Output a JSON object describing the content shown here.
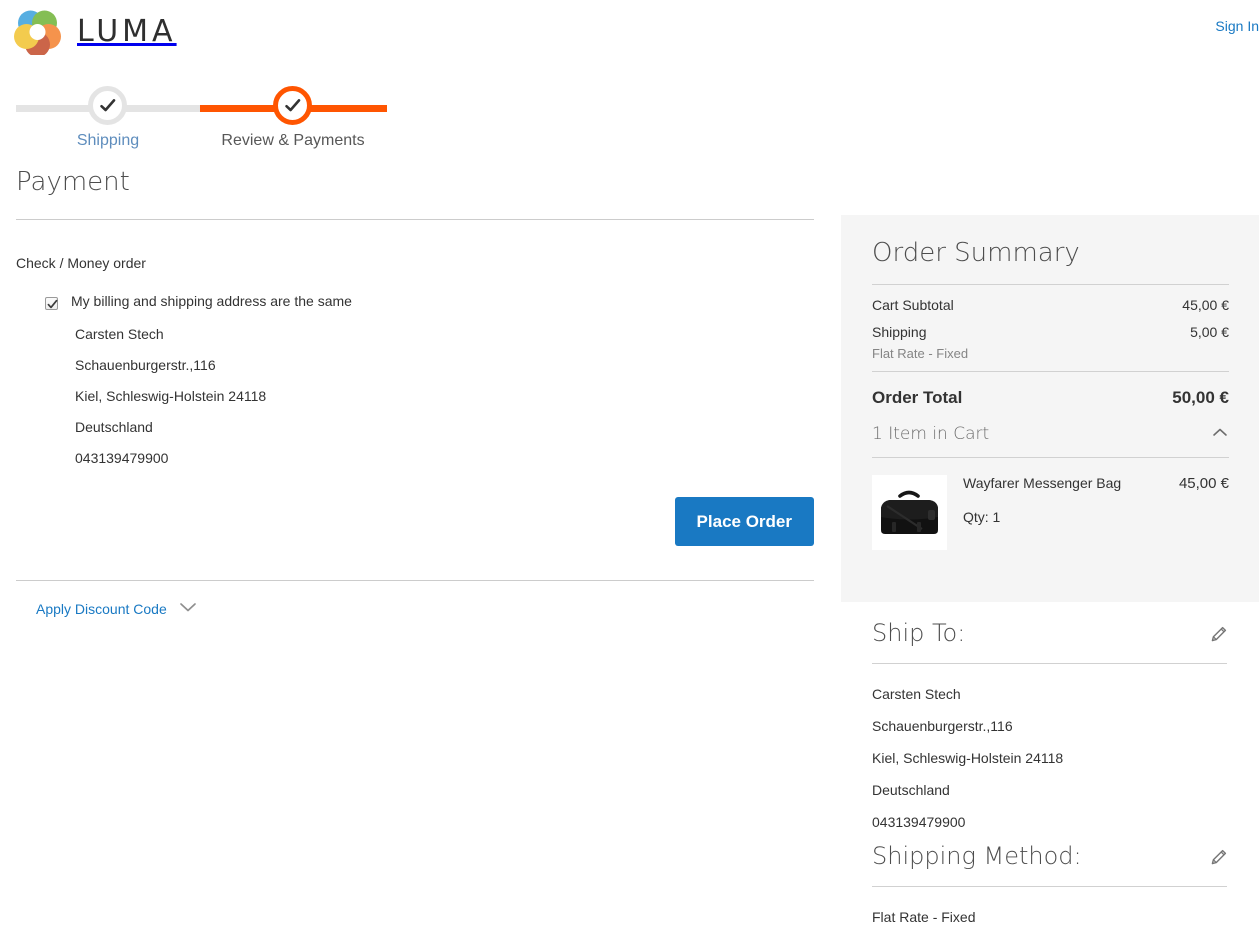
{
  "header": {
    "brand": "LUMA",
    "brand_logo_icon": "luma-circles-logo",
    "signin_label": "Sign In"
  },
  "progress": {
    "steps": [
      {
        "label": "Shipping",
        "state": "completed",
        "icon": "check-icon"
      },
      {
        "label": "Review & Payments",
        "state": "active",
        "icon": "check-icon"
      }
    ],
    "active_color": "#ff5501",
    "inactive_color": "#e4e4e4"
  },
  "payment": {
    "title": "Payment",
    "method_label": "Check / Money order",
    "same_address_label": "My billing and shipping address are the same",
    "same_address_checked": true,
    "billing_address": [
      "Carsten Stech",
      "Schauenburgerstr.,116",
      "Kiel, Schleswig-Holstein 24118",
      "Deutschland",
      "043139479900"
    ],
    "place_order_label": "Place Order",
    "place_order_color": "#1979c3",
    "discount_label": "Apply Discount Code",
    "discount_icon": "chevron-down-icon"
  },
  "order_summary": {
    "title": "Order Summary",
    "totals": [
      {
        "label": "Cart Subtotal",
        "value": "45,00 €",
        "sub": ""
      },
      {
        "label": "Shipping",
        "value": "5,00 €",
        "sub": "Flat Rate - Fixed"
      }
    ],
    "grand_total": {
      "label": "Order Total",
      "value": "50,00 €"
    },
    "items_header": "1 Item in Cart",
    "items_toggle_icon": "chevron-up-icon",
    "items": [
      {
        "name": "Wayfarer Messenger Bag",
        "price": "45,00 €",
        "qty_label": "Qty: 1",
        "thumb_icon": "messenger-bag-thumbnail"
      }
    ]
  },
  "ship_to": {
    "title": "Ship To:",
    "edit_icon": "pencil-edit-icon",
    "address": [
      "Carsten Stech",
      "Schauenburgerstr.,116",
      "Kiel, Schleswig-Holstein 24118",
      "Deutschland",
      "043139479900"
    ]
  },
  "shipping_method": {
    "title": "Shipping Method:",
    "edit_icon": "pencil-edit-icon",
    "value": "Flat Rate - Fixed"
  }
}
